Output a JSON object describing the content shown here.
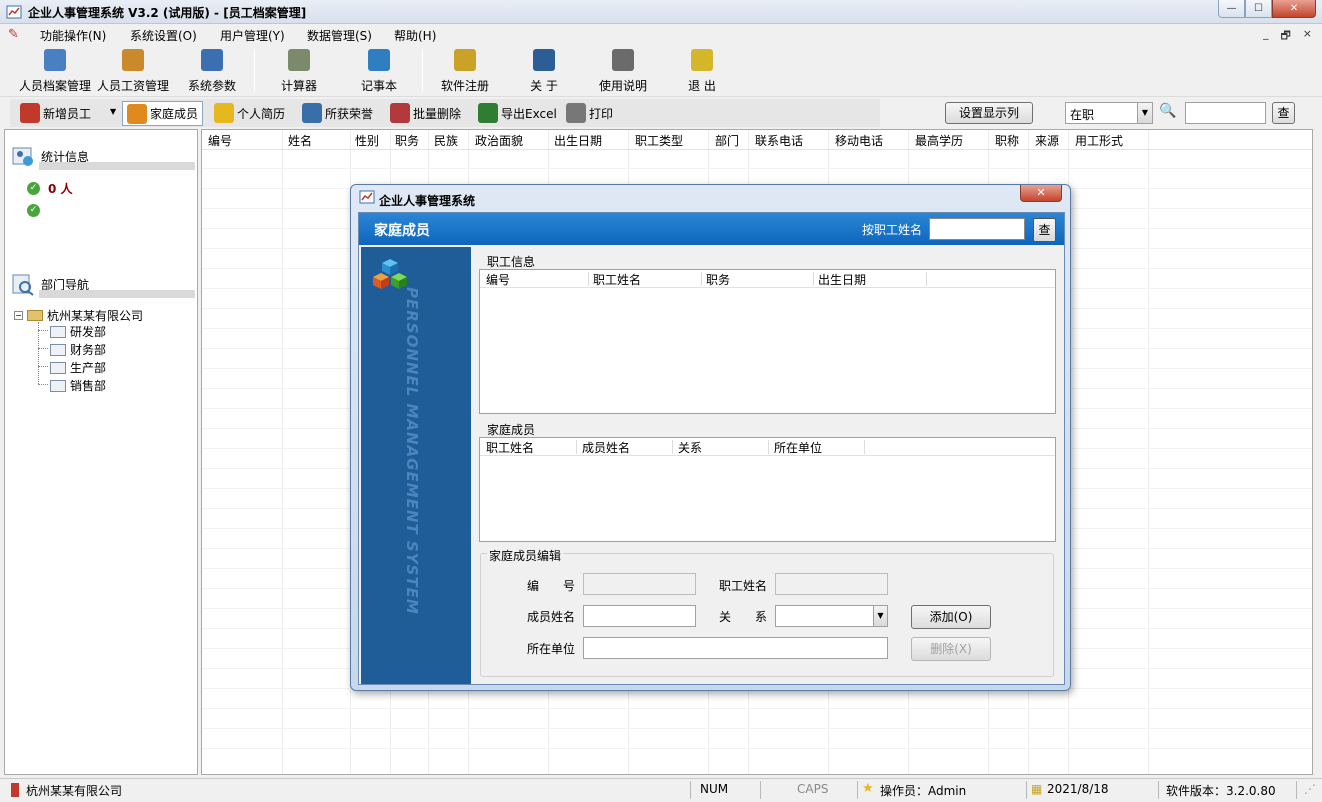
{
  "window": {
    "title": "企业人事管理系统 V3.2 (试用版) - [员工档案管理]",
    "min_label": "—",
    "max_label": "☐",
    "close_label": "✕"
  },
  "menu": {
    "items": [
      "功能操作(N)",
      "系统设置(O)",
      "用户管理(Y)",
      "数据管理(S)",
      "帮助(H)"
    ],
    "mdi": {
      "min": "_",
      "restore": "🗗",
      "close": "×"
    }
  },
  "toolbar": {
    "buttons": [
      {
        "label": "人员档案管理",
        "icon": "edit-doc-icon",
        "color": "#4a7fc1"
      },
      {
        "label": "人员工资管理",
        "icon": "salary-user-icon",
        "color": "#c98a2c"
      },
      {
        "label": "系统参数",
        "icon": "calendar-grid-icon",
        "color": "#3b6fb0"
      },
      {
        "label": "计算器",
        "icon": "calculator-icon",
        "color": "#7a8a6a"
      },
      {
        "label": "记事本",
        "icon": "notebook-icon",
        "color": "#2f7fc0"
      },
      {
        "label": "软件注册",
        "icon": "keys-icon",
        "color": "#c9a227"
      },
      {
        "label": "关 于",
        "icon": "info-icon",
        "color": "#2d5d95"
      },
      {
        "label": "使用说明",
        "icon": "document-icon",
        "color": "#6b6b6b"
      },
      {
        "label": "退 出",
        "icon": "exit-icon",
        "color": "#d4b62b"
      }
    ]
  },
  "toolbar2": {
    "buttons": [
      {
        "label": "新增员工",
        "icon": "add-user-icon",
        "color": "#c0392b"
      },
      {
        "label": "家庭成员",
        "icon": "family-icon",
        "color": "#e08a1e"
      },
      {
        "label": "个人简历",
        "icon": "star-icon",
        "color": "#e5b81f"
      },
      {
        "label": "所获荣誉",
        "icon": "honor-icon",
        "color": "#3a6ea8"
      },
      {
        "label": "批量删除",
        "icon": "batch-delete-icon",
        "color": "#b23a3a"
      },
      {
        "label": "导出Excel",
        "icon": "excel-icon",
        "color": "#2e7d32"
      },
      {
        "label": "打印",
        "icon": "printer-icon",
        "color": "#777777"
      }
    ],
    "dropdown_arrow": "▼",
    "display_columns_label": "设置显示列",
    "status_filter": "在职",
    "search_glyph": "🔍",
    "search_value": "",
    "query_label": "查"
  },
  "left": {
    "stats_title": "统计信息",
    "stats": [
      {
        "mark": "✓",
        "count": "0 人"
      },
      {
        "mark": "✓",
        "count": ""
      }
    ],
    "dept_title": "部门导航",
    "company": "杭州某某有限公司",
    "tree_toggle": "−",
    "departments": [
      "研发部",
      "财务部",
      "生产部",
      "销售部"
    ]
  },
  "grid": {
    "columns": [
      "编号",
      "姓名",
      "性别",
      "职务",
      "民族",
      "政治面貌",
      "出生日期",
      "职工类型",
      "部门",
      "联系电话",
      "移动电话",
      "最高学历",
      "职称",
      "来源",
      "用工形式"
    ]
  },
  "dialog": {
    "title": "企业人事管理系统",
    "close_label": "✕",
    "band_title": "家庭成员",
    "search_label": "按职工姓名",
    "search_value": "",
    "search_button": "查",
    "side_text": "PERSONNEL MANAGEMENT SYSTEM",
    "emp_section": "职工信息",
    "emp_columns": [
      "编号",
      "职工姓名",
      "职务",
      "出生日期"
    ],
    "family_section": "家庭成员",
    "family_columns": [
      "职工姓名",
      "成员姓名",
      "关系",
      "所在单位"
    ],
    "edit_section": "家庭成员编辑",
    "fields": {
      "id_label": "编　　号",
      "emp_name_label": "职工姓名",
      "member_name_label": "成员姓名",
      "relation_label": "关　　系",
      "unit_label": "所在单位",
      "id_value": "",
      "emp_name_value": "",
      "member_name_value": "",
      "relation_value": "",
      "unit_value": ""
    },
    "combo_arrow": "▼",
    "add_button": "添加(O)",
    "delete_button": "删除(X)"
  },
  "status": {
    "company": "杭州某某有限公司",
    "num": "NUM",
    "caps": "CAPS",
    "operator": "操作员：Admin",
    "date": "2021/8/18",
    "version": "软件版本：3.2.0.80"
  }
}
